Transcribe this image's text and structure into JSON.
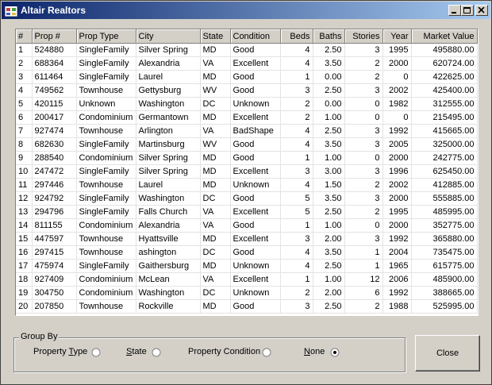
{
  "window": {
    "title": "Altair Realtors"
  },
  "grid": {
    "columns": [
      "#",
      "Prop #",
      "Prop Type",
      "City",
      "State",
      "Condition",
      "Beds",
      "Baths",
      "Stories",
      "Year",
      "Market Value"
    ],
    "rows": [
      [
        "1",
        "524880",
        "SingleFamily",
        "Silver Spring",
        "MD",
        "Good",
        "4",
        "2.50",
        "3",
        "1995",
        "495880.00"
      ],
      [
        "2",
        "688364",
        "SingleFamily",
        "Alexandria",
        "VA",
        "Excellent",
        "4",
        "3.50",
        "2",
        "2000",
        "620724.00"
      ],
      [
        "3",
        "611464",
        "SingleFamily",
        "Laurel",
        "MD",
        "Good",
        "1",
        "0.00",
        "2",
        "0",
        "422625.00"
      ],
      [
        "4",
        "749562",
        "Townhouse",
        "Gettysburg",
        "WV",
        "Good",
        "3",
        "2.50",
        "3",
        "2002",
        "425400.00"
      ],
      [
        "5",
        "420115",
        "Unknown",
        "Washington",
        "DC",
        "Unknown",
        "2",
        "0.00",
        "0",
        "1982",
        "312555.00"
      ],
      [
        "6",
        "200417",
        "Condominium",
        "Germantown",
        "MD",
        "Excellent",
        "2",
        "1.00",
        "0",
        "0",
        "215495.00"
      ],
      [
        "7",
        "927474",
        "Townhouse",
        "Arlington",
        "VA",
        "BadShape",
        "4",
        "2.50",
        "3",
        "1992",
        "415665.00"
      ],
      [
        "8",
        "682630",
        "SingleFamily",
        "Martinsburg",
        "WV",
        "Good",
        "4",
        "3.50",
        "3",
        "2005",
        "325000.00"
      ],
      [
        "9",
        "288540",
        "Condominium",
        "Silver Spring",
        "MD",
        "Good",
        "1",
        "1.00",
        "0",
        "2000",
        "242775.00"
      ],
      [
        "10",
        "247472",
        "SingleFamily",
        "Silver Spring",
        "MD",
        "Excellent",
        "3",
        "3.00",
        "3",
        "1996",
        "625450.00"
      ],
      [
        "11",
        "297446",
        "Townhouse",
        "Laurel",
        "MD",
        "Unknown",
        "4",
        "1.50",
        "2",
        "2002",
        "412885.00"
      ],
      [
        "12",
        "924792",
        "SingleFamily",
        "Washington",
        "DC",
        "Good",
        "5",
        "3.50",
        "3",
        "2000",
        "555885.00"
      ],
      [
        "13",
        "294796",
        "SingleFamily",
        "Falls Church",
        "VA",
        "Excellent",
        "5",
        "2.50",
        "2",
        "1995",
        "485995.00"
      ],
      [
        "14",
        "811155",
        "Condominium",
        "Alexandria",
        "VA",
        "Good",
        "1",
        "1.00",
        "0",
        "2000",
        "352775.00"
      ],
      [
        "15",
        "447597",
        "Townhouse",
        "Hyattsville",
        "MD",
        "Excellent",
        "3",
        "2.00",
        "3",
        "1992",
        "365880.00"
      ],
      [
        "16",
        "297415",
        "Townhouse",
        "ashington",
        "DC",
        "Good",
        "4",
        "3.50",
        "1",
        "2004",
        "735475.00"
      ],
      [
        "17",
        "475974",
        "SingleFamily",
        "Gaithersburg",
        "MD",
        "Unknown",
        "4",
        "2.50",
        "1",
        "1965",
        "615775.00"
      ],
      [
        "18",
        "927409",
        "Condominium",
        "McLean",
        "VA",
        "Excellent",
        "1",
        "1.00",
        "12",
        "2006",
        "485900.00"
      ],
      [
        "19",
        "304750",
        "Condominium",
        "Washington",
        "DC",
        "Unknown",
        "2",
        "2.00",
        "6",
        "1992",
        "388665.00"
      ],
      [
        "20",
        "207850",
        "Townhouse",
        "Rockville",
        "MD",
        "Good",
        "3",
        "2.50",
        "2",
        "1988",
        "525995.00"
      ]
    ]
  },
  "group_by": {
    "title": "Group By",
    "options": [
      {
        "label_pre": "Property ",
        "label_u": "T",
        "label_post": "ype",
        "selected": false
      },
      {
        "label_pre": "",
        "label_u": "S",
        "label_post": "tate",
        "selected": false
      },
      {
        "label_pre": "Property Condition",
        "label_u": "",
        "label_post": "",
        "selected": false
      },
      {
        "label_pre": "",
        "label_u": "N",
        "label_post": "one",
        "selected": true
      }
    ]
  },
  "buttons": {
    "close": "Close"
  }
}
